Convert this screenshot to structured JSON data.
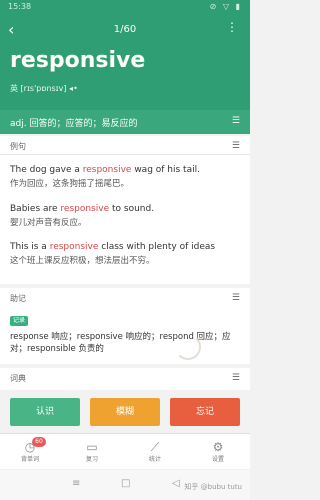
{
  "status": {
    "time": "15:38",
    "icons": "⊘ ▽ ▮"
  },
  "header": {
    "back": "‹",
    "counter": "1/60",
    "more": "⋮",
    "word": "responsive",
    "phonetic": "英 [rɪs'pɒnsɪv] ◂•"
  },
  "definition": "adj. 回答的；应答的；易反应的",
  "examples_section": {
    "title": "例句",
    "items": [
      {
        "pre": "The dog gave a ",
        "hl": "responsive",
        "post": " wag of his tail.",
        "zh": "作为回应，这条狗摇了摇尾巴。"
      },
      {
        "pre": "Babies are ",
        "hl": "responsive",
        "post": " to sound.",
        "zh": "婴儿对声音有反应。"
      },
      {
        "pre": "This is a ",
        "hl": "responsive",
        "post": " class with plenty of ideas",
        "zh": "这个班上课反应积极，想法层出不穷。"
      }
    ]
  },
  "mnemonic_section": {
    "title": "助记",
    "tag": "记录",
    "text": "response 响应；responsive 响应的；respond 回应；应对；responsible 负责的"
  },
  "derivatives_section": {
    "title": "词典"
  },
  "buttons": {
    "know": "认识",
    "vague": "模糊",
    "forget": "忘记"
  },
  "tabs": [
    {
      "label": "背单词",
      "badge": "60"
    },
    {
      "label": "复习"
    },
    {
      "label": "统计"
    },
    {
      "label": "设置"
    }
  ],
  "colors": {
    "header": "#2f9e74",
    "highlight": "#d44848",
    "know": "#49b587",
    "vague": "#f0a230",
    "forget": "#e85f3f"
  },
  "watermark": "知乎 @bubu tutu"
}
